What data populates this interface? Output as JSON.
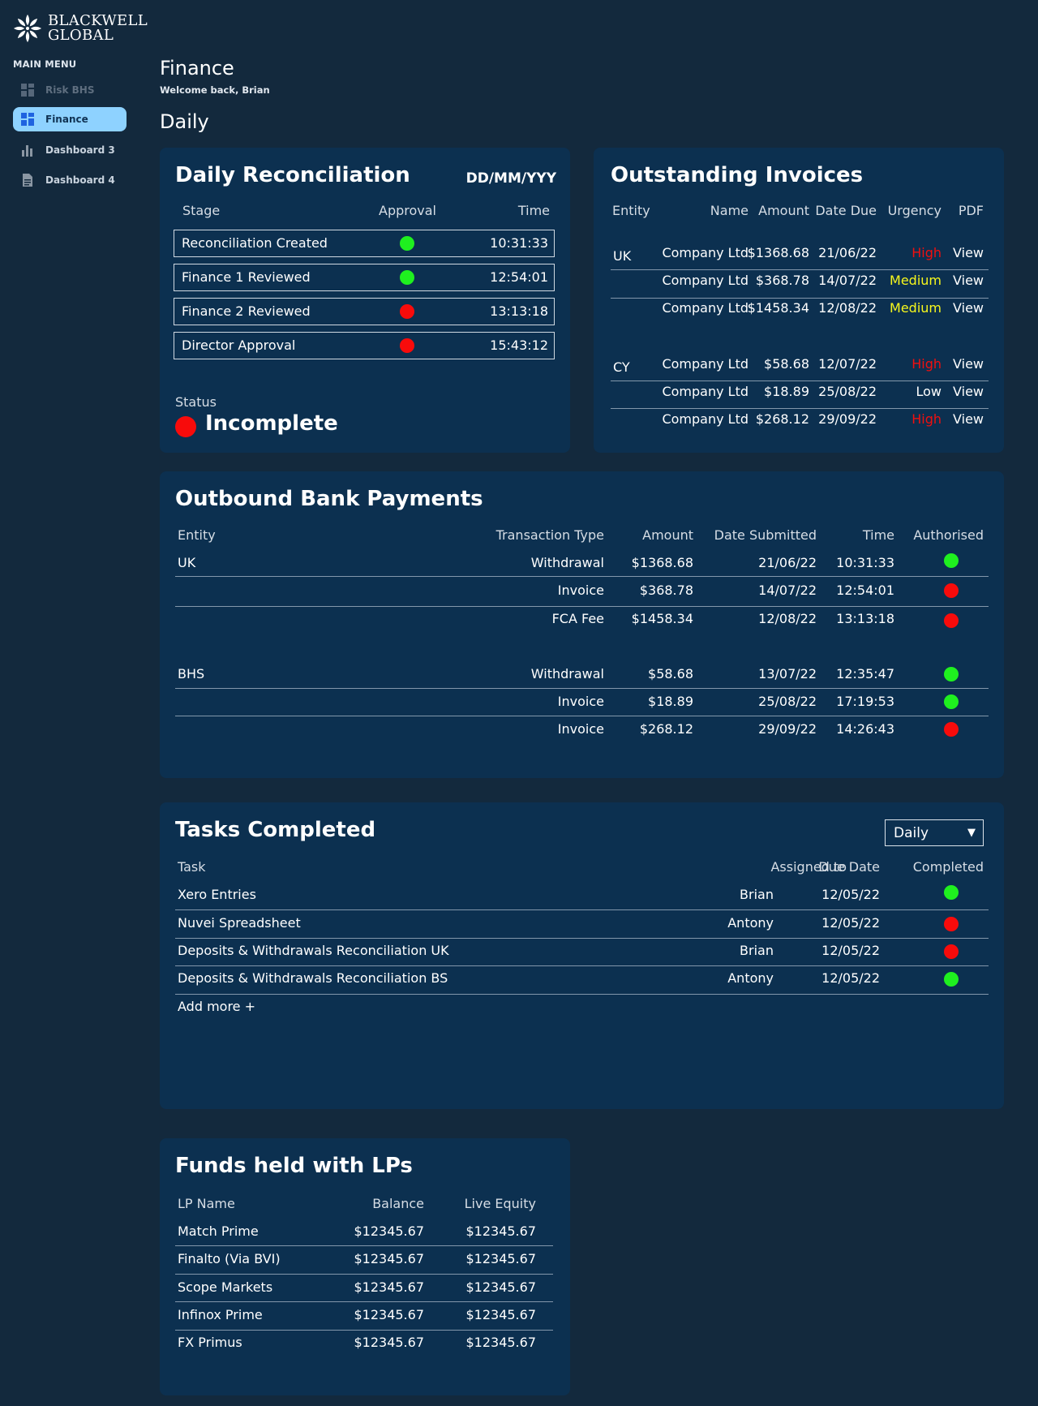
{
  "brand": {
    "line1": "BLACKWELL",
    "line2": "GLOBAL"
  },
  "sidebar": {
    "title": "MAIN MENU",
    "items": [
      {
        "label": "Risk BHS",
        "icon": "dashboard-grid-icon",
        "state": "disabled"
      },
      {
        "label": "Finance",
        "icon": "dashboard-grid-icon",
        "state": "active"
      },
      {
        "label": "Dashboard 3",
        "icon": "bar-chart-icon",
        "state": "normal"
      },
      {
        "label": "Dashboard 4",
        "icon": "document-icon",
        "state": "normal"
      }
    ]
  },
  "header": {
    "title": "Finance",
    "welcome": "Welcome back, Brian",
    "section": "Daily"
  },
  "reconciliation": {
    "title": "Daily Reconciliation",
    "date": "DD/MM/YYY",
    "columns": [
      "Stage",
      "Approval",
      "Time"
    ],
    "rows": [
      {
        "stage": "Reconciliation Created",
        "approval": "green",
        "time": "10:31:33"
      },
      {
        "stage": "Finance 1 Reviewed",
        "approval": "green",
        "time": "12:54:01"
      },
      {
        "stage": "Finance 2 Reviewed",
        "approval": "red",
        "time": "13:13:18"
      },
      {
        "stage": "Director Approval",
        "approval": "red",
        "time": "15:43:12"
      }
    ],
    "status_label": "Status",
    "status_value": "Incomplete",
    "status_color": "#f80b0b"
  },
  "invoices": {
    "title": "Outstanding Invoices",
    "columns": [
      "Entity",
      "Name",
      "Amount",
      "Date Due",
      "Urgency",
      "PDF"
    ],
    "groups": [
      {
        "entity": "UK",
        "rows": [
          {
            "name": "Company Ltd",
            "amount": "$1368.68",
            "due": "21/06/22",
            "urgency": "High",
            "pdf": "View"
          },
          {
            "name": "Company Ltd",
            "amount": "$368.78",
            "due": "14/07/22",
            "urgency": "Medium",
            "pdf": "View"
          },
          {
            "name": "Company Ltd",
            "amount": "$1458.34",
            "due": "12/08/22",
            "urgency": "Medium",
            "pdf": "View"
          }
        ]
      },
      {
        "entity": "CY",
        "rows": [
          {
            "name": "Company Ltd",
            "amount": "$58.68",
            "due": "12/07/22",
            "urgency": "High",
            "pdf": "View"
          },
          {
            "name": "Company Ltd",
            "amount": "$18.89",
            "due": "25/08/22",
            "urgency": "Low",
            "pdf": "View"
          },
          {
            "name": "Company Ltd",
            "amount": "$268.12",
            "due": "29/09/22",
            "urgency": "High",
            "pdf": "View"
          }
        ]
      }
    ],
    "urgency_colors": {
      "High": "#f00f0f",
      "Medium": "#f7f71c",
      "Low": "#ffffff"
    }
  },
  "payments": {
    "title": "Outbound Bank Payments",
    "columns": [
      "Entity",
      "Transaction Type",
      "Amount",
      "Date Submitted",
      "Time",
      "Authorised"
    ],
    "groups": [
      {
        "entity": "UK",
        "rows": [
          {
            "type": "Withdrawal",
            "amount": "$1368.68",
            "date": "21/06/22",
            "time": "10:31:33",
            "authorised": "green"
          },
          {
            "type": "Invoice",
            "amount": "$368.78",
            "date": "14/07/22",
            "time": "12:54:01",
            "authorised": "red"
          },
          {
            "type": "FCA Fee",
            "amount": "$1458.34",
            "date": "12/08/22",
            "time": "13:13:18",
            "authorised": "red"
          }
        ]
      },
      {
        "entity": "BHS",
        "rows": [
          {
            "type": "Withdrawal",
            "amount": "$58.68",
            "date": "13/07/22",
            "time": "12:35:47",
            "authorised": "green"
          },
          {
            "type": "Invoice",
            "amount": "$18.89",
            "date": "25/08/22",
            "time": "17:19:53",
            "authorised": "green"
          },
          {
            "type": "Invoice",
            "amount": "$268.12",
            "date": "29/09/22",
            "time": "14:26:43",
            "authorised": "red"
          }
        ]
      }
    ]
  },
  "tasks": {
    "title": "Tasks Completed",
    "filter": "Daily",
    "columns": [
      "Task",
      "Assigned to",
      "Due Date",
      "Completed"
    ],
    "rows": [
      {
        "task": "Xero Entries",
        "assigned": "Brian",
        "due": "12/05/22",
        "completed": "green"
      },
      {
        "task": "Nuvei Spreadsheet",
        "assigned": "Antony",
        "due": "12/05/22",
        "completed": "red"
      },
      {
        "task": "Deposits & Withdrawals Reconciliation UK",
        "assigned": "Brian",
        "due": "12/05/22",
        "completed": "red"
      },
      {
        "task": "Deposits & Withdrawals Reconciliation BS",
        "assigned": "Antony",
        "due": "12/05/22",
        "completed": "green"
      }
    ],
    "add_more": "Add more +"
  },
  "funds": {
    "title": "Funds held with LPs",
    "columns": [
      "LP Name",
      "Balance",
      "Live Equity"
    ],
    "rows": [
      {
        "name": "Match Prime",
        "balance": "$12345.67",
        "equity": "$12345.67"
      },
      {
        "name": "Finalto (Via BVI)",
        "balance": "$12345.67",
        "equity": "$12345.67"
      },
      {
        "name": "Scope Markets",
        "balance": "$12345.67",
        "equity": "$12345.67"
      },
      {
        "name": "Infinox Prime",
        "balance": "$12345.67",
        "equity": "$12345.67"
      },
      {
        "name": "FX Primus",
        "balance": "$12345.67",
        "equity": "$12345.67"
      }
    ]
  },
  "colors": {
    "background": "#13293d",
    "card": "#0c3050",
    "active_nav": "#8ed2ff",
    "ok": "#1ff01f",
    "bad": "#f80b0b"
  }
}
